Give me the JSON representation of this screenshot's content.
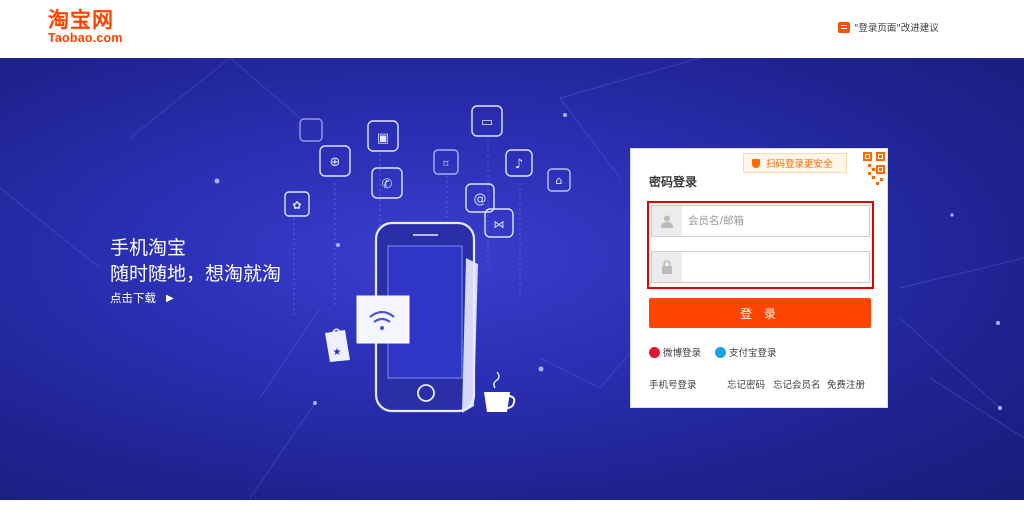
{
  "header": {
    "logo_cn": "淘宝网",
    "logo_en": "Taobao.com",
    "feedback": "\"登录页面\"改进建议"
  },
  "promo": {
    "title": "手机淘宝",
    "subtitle": "随时随地，想淘就淘",
    "download": "点击下载",
    "download_arrow": "▶"
  },
  "login": {
    "title": "密码登录",
    "qr_tip": "扫码登录更安全",
    "username_placeholder": "会员名/邮箱",
    "password_placeholder": "",
    "submit": "登 录",
    "weibo": "微博登录",
    "alipay": "支付宝登录",
    "links": [
      "手机号登录",
      "忘记密码",
      "忘记会员名",
      "免费注册"
    ]
  },
  "colors": {
    "brand": "#ff4400",
    "banner": "#2b2fb4",
    "highlight_frame": "#e60000"
  }
}
